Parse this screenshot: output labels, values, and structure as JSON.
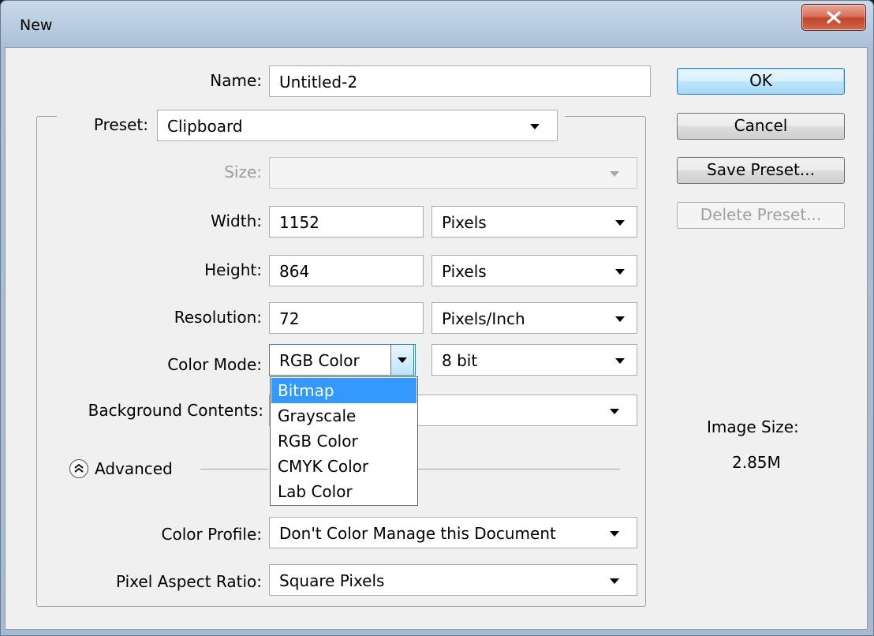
{
  "window": {
    "title": "New",
    "close_symbol": "x"
  },
  "name": {
    "label": "Name:",
    "value": "Untitled-2"
  },
  "preset": {
    "label": "Preset:",
    "value": "Clipboard"
  },
  "size": {
    "label": "Size:",
    "value": ""
  },
  "width": {
    "label": "Width:",
    "value": "1152",
    "unit": "Pixels"
  },
  "height": {
    "label": "Height:",
    "value": "864",
    "unit": "Pixels"
  },
  "resolution": {
    "label": "Resolution:",
    "value": "72",
    "unit": "Pixels/Inch"
  },
  "color_mode": {
    "label": "Color Mode:",
    "value": "RGB Color",
    "bit_depth": "8 bit",
    "options": [
      "Bitmap",
      "Grayscale",
      "RGB Color",
      "CMYK Color",
      "Lab Color"
    ],
    "highlighted_option": "Bitmap"
  },
  "background_contents": {
    "label": "Background Contents:",
    "value": ""
  },
  "advanced": {
    "label": "Advanced",
    "icon": "chevron-up-double-icon"
  },
  "color_profile": {
    "label": "Color Profile:",
    "value": "Don't Color Manage this Document"
  },
  "pixel_aspect_ratio": {
    "label": "Pixel Aspect Ratio:",
    "value": "Square Pixels"
  },
  "buttons": {
    "ok": "OK",
    "cancel": "Cancel",
    "save_preset": "Save Preset...",
    "delete_preset": "Delete Preset..."
  },
  "image_size": {
    "label": "Image Size:",
    "value": "2.85M"
  },
  "colors": {
    "highlight": "#3399ff",
    "dialog_bg": "#f0f0f0",
    "close_button": "#c2452b"
  }
}
